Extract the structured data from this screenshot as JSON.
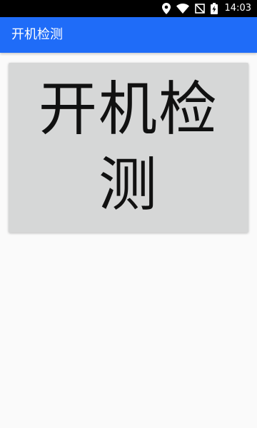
{
  "status_bar": {
    "time": "14:03",
    "icons": [
      "location-icon",
      "wifi-icon",
      "no-signal-icon",
      "battery-charging-icon"
    ]
  },
  "app_bar": {
    "title": "开机检测",
    "background_color": "#1f6cf8"
  },
  "main": {
    "button_label": "开机检测",
    "button_color": "#d6d7d7"
  }
}
